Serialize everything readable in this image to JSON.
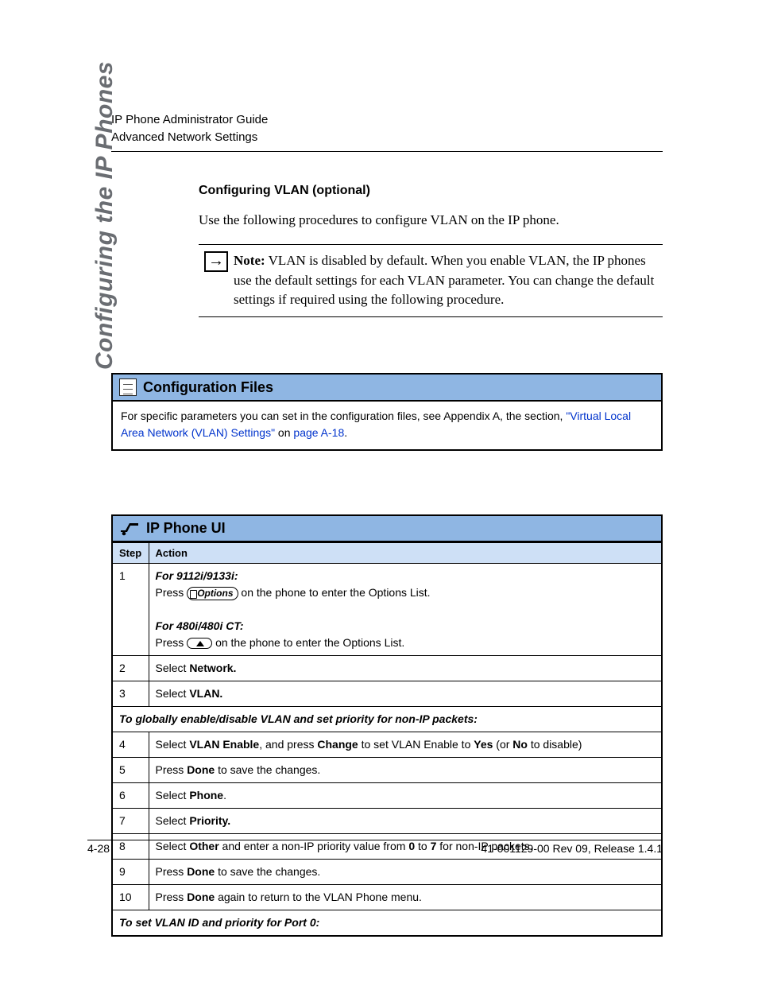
{
  "header": {
    "line1": "IP Phone Administrator Guide",
    "line2": "Advanced Network Settings"
  },
  "side_tab": "Configuring the IP Phones",
  "section": {
    "title": "Configuring VLAN (optional)",
    "intro": "Use the following procedures to configure VLAN on the IP phone.",
    "note_label": "Note:",
    "note_body": " VLAN is disabled by default. When you enable VLAN, the IP phones use the default settings for each VLAN parameter. You can change the default settings if required using the following procedure."
  },
  "config_files": {
    "heading": "Configuration Files",
    "body_pre": "For specific parameters you can set in the configuration files, see Appendix A, the section, ",
    "link1": "\"Virtual Local Area Network (VLAN) Settings\"",
    "body_mid": " on ",
    "link2": "page A-18",
    "body_post": "."
  },
  "ip_phone_ui": {
    "heading": "IP Phone UI",
    "cols": {
      "step": "Step",
      "action": "Action"
    },
    "row1": {
      "step": "1",
      "for_a": "For 9112i/9133i:",
      "press_a1": "Press ",
      "options_label": "Options",
      "press_a2": " on the phone to enter the Options List.",
      "for_b": "For 480i/480i CT:",
      "press_b1": "Press ",
      "press_b2": " on the phone to enter the Options List."
    },
    "row2": {
      "step": "2",
      "pre": "Select ",
      "bold": "Network."
    },
    "row3": {
      "step": "3",
      "pre": "Select ",
      "bold": "VLAN."
    },
    "span1": "To globally enable/disable VLAN and set priority for non-IP packets:",
    "row4": {
      "step": "4",
      "p1": "Select ",
      "b1": "VLAN Enable",
      "p2": ", and press ",
      "b2": "Change",
      "p3": " to set VLAN Enable to ",
      "b3": "Yes",
      "p4": " (or ",
      "b4": "No",
      "p5": " to disable)"
    },
    "row5": {
      "step": "5",
      "p1": "Press ",
      "b1": "Done",
      "p2": " to save the changes."
    },
    "row6": {
      "step": "6",
      "p1": "Select ",
      "b1": "Phone",
      "p2": "."
    },
    "row7": {
      "step": "7",
      "p1": "Select ",
      "b1": "Priority."
    },
    "row8": {
      "step": "8",
      "p1": "Select ",
      "b1": "Other",
      "p2": " and enter a non-IP priority value from ",
      "b2": "0",
      "p3": " to ",
      "b3": "7",
      "p4": " for non-IP packets."
    },
    "row9": {
      "step": "9",
      "p1": "Press ",
      "b1": "Done",
      "p2": " to save the changes."
    },
    "row10": {
      "step": "10",
      "p1": "Press ",
      "b1": "Done",
      "p2": " again to return to the VLAN Phone menu."
    },
    "span2": "To set VLAN ID and priority for Port 0:"
  },
  "footer": {
    "page": "4-28",
    "rev": "41-001129-00 Rev 09, Release 1.4.1"
  }
}
